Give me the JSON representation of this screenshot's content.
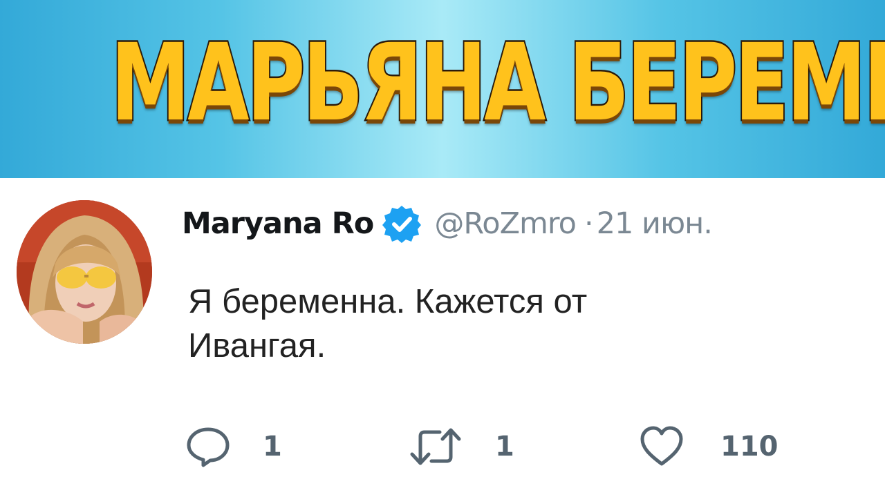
{
  "banner": {
    "title": "МАРЬЯНА БЕРЕМЕННА"
  },
  "tweet": {
    "display_name": "Maryana Ro",
    "verified": true,
    "handle": "@RoZmro",
    "separator": "·",
    "date": "21 июн.",
    "text_lines": [
      "Я беременна. Кажется от",
      "Ивангая."
    ],
    "actions": {
      "reply_count": "1",
      "retweet_count": "1",
      "like_count": "110"
    }
  },
  "colors": {
    "banner_title_fill": "#ffc21c",
    "banner_bg": "#55c4e6",
    "verified_blue": "#1da1f2",
    "muted_text": "#7b8893",
    "icon_gray": "#556470"
  },
  "icons": {
    "verified": "verified-badge-icon",
    "reply": "reply-icon",
    "retweet": "retweet-icon",
    "like": "heart-icon"
  }
}
